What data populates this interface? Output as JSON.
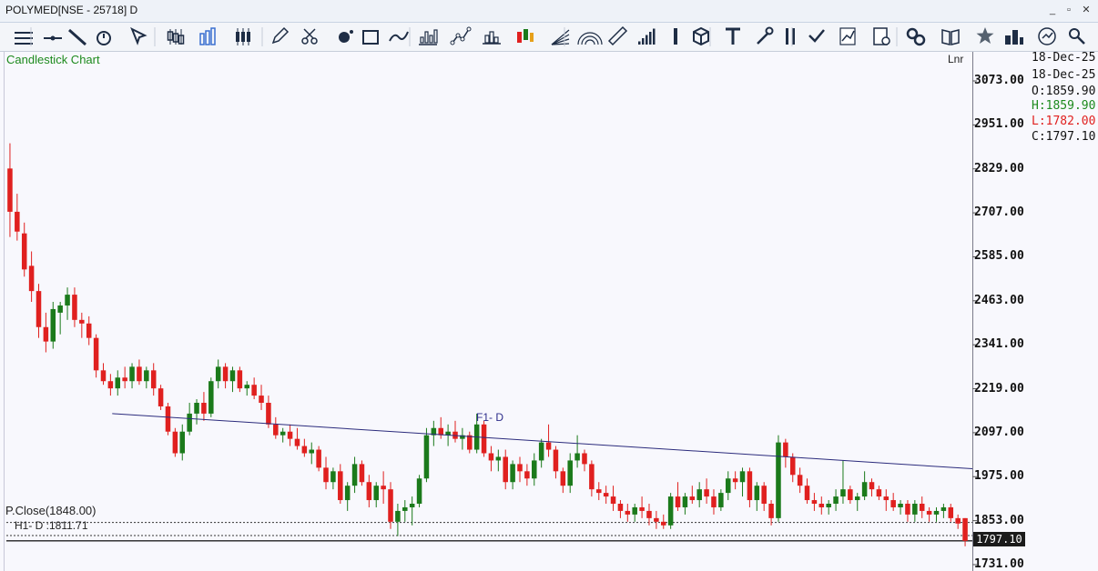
{
  "window": {
    "title": "POLYMED[NSE - 25718] D",
    "min_label": "_",
    "restore_label": "▫",
    "close_label": "✕"
  },
  "toolbar": {
    "icons": [
      "menu-icon",
      "line-tool-icon",
      "trendline-icon",
      "timer-icon",
      "pointer-icon",
      "candle-style-icon",
      "bar-style-icon",
      "candles-icon",
      "pencil-icon",
      "scissors-icon",
      "splat-icon",
      "rectangle-icon",
      "wave-icon",
      "bar-chart-icon",
      "line-chart-icon",
      "histogram-icon",
      "colored-candles-icon",
      "fan-icon",
      "arc-icon",
      "ruler-icon",
      "volume-bars-icon",
      "cursor-bar-icon",
      "cube-icon",
      "text-tool-icon",
      "wrench-icon",
      "pause-bars-icon",
      "down-arrow-icon",
      "scatter-chart-icon",
      "document-settings-icon",
      "link-icon",
      "book-icon",
      "star-icon",
      "grid-icon",
      "compare-icon",
      "zoom-icon"
    ]
  },
  "chart": {
    "title": "Candlestick Chart",
    "scale_mode": "Lnr",
    "info": {
      "date1": "18-Dec-25",
      "date2": "18-Dec-25",
      "open": "O:1859.90",
      "high": "H:1859.90",
      "low": "L:1782.00",
      "close": "C:1797.10"
    },
    "last_price_tag": "1797.10",
    "prev_close_label": "P.Close(1848.00)",
    "h1_label": "H1- D :1811.71",
    "f1_label": "F1- D",
    "colors": {
      "up": "#1b7a1b",
      "down": "#e0201f",
      "trendline": "#2b2b7c",
      "title": "#1d8a1d",
      "high": "#1d8a1d",
      "low": "#e0201f"
    }
  },
  "chart_data": {
    "type": "candlestick",
    "title": "Candlestick Chart",
    "y_ticks": [
      3073.0,
      2951.0,
      2829.0,
      2707.0,
      2585.0,
      2463.0,
      2341.0,
      2219.0,
      2097.0,
      1975.0,
      1853.0,
      1731.0
    ],
    "ylim": [
      1710,
      3160
    ],
    "scale": "linear",
    "reference_lines": [
      {
        "name": "P.Close",
        "value": 1848.0
      },
      {
        "name": "H1- D",
        "value": 1811.71
      }
    ],
    "trendline": {
      "name": "F1- D",
      "from_index": 0.11,
      "from_value": 2150,
      "to_index": 1.0,
      "to_value": 1997
    },
    "last": {
      "open": 1859.9,
      "high": 1859.9,
      "low": 1782.0,
      "close": 1797.1
    },
    "candles": [
      [
        2830,
        2900,
        2640,
        2710
      ],
      [
        2710,
        2760,
        2630,
        2655
      ],
      [
        2650,
        2680,
        2530,
        2550
      ],
      [
        2560,
        2600,
        2460,
        2490
      ],
      [
        2490,
        2510,
        2360,
        2390
      ],
      [
        2390,
        2430,
        2320,
        2350
      ],
      [
        2350,
        2460,
        2330,
        2440
      ],
      [
        2430,
        2460,
        2370,
        2450
      ],
      [
        2450,
        2500,
        2410,
        2480
      ],
      [
        2480,
        2500,
        2390,
        2410
      ],
      [
        2410,
        2430,
        2360,
        2400
      ],
      [
        2400,
        2420,
        2340,
        2360
      ],
      [
        2360,
        2370,
        2250,
        2270
      ],
      [
        2270,
        2290,
        2230,
        2240
      ],
      [
        2240,
        2260,
        2200,
        2220
      ],
      [
        2220,
        2270,
        2200,
        2250
      ],
      [
        2250,
        2280,
        2220,
        2240
      ],
      [
        2240,
        2290,
        2220,
        2280
      ],
      [
        2280,
        2300,
        2230,
        2240
      ],
      [
        2240,
        2280,
        2220,
        2270
      ],
      [
        2270,
        2290,
        2200,
        2220
      ],
      [
        2220,
        2230,
        2160,
        2170
      ],
      [
        2170,
        2180,
        2090,
        2100
      ],
      [
        2100,
        2110,
        2030,
        2040
      ],
      [
        2040,
        2120,
        2020,
        2100
      ],
      [
        2100,
        2180,
        2090,
        2150
      ],
      [
        2150,
        2190,
        2120,
        2180
      ],
      [
        2180,
        2210,
        2130,
        2150
      ],
      [
        2150,
        2250,
        2140,
        2240
      ],
      [
        2240,
        2300,
        2220,
        2280
      ],
      [
        2280,
        2290,
        2220,
        2240
      ],
      [
        2240,
        2280,
        2210,
        2270
      ],
      [
        2270,
        2280,
        2210,
        2220
      ],
      [
        2220,
        2240,
        2200,
        2230
      ],
      [
        2230,
        2250,
        2190,
        2200
      ],
      [
        2200,
        2230,
        2160,
        2180
      ],
      [
        2180,
        2200,
        2110,
        2120
      ],
      [
        2120,
        2140,
        2080,
        2090
      ],
      [
        2090,
        2110,
        2070,
        2100
      ],
      [
        2100,
        2120,
        2060,
        2080
      ],
      [
        2080,
        2110,
        2050,
        2060
      ],
      [
        2060,
        2080,
        2030,
        2040
      ],
      [
        2040,
        2070,
        2010,
        2050
      ],
      [
        2050,
        2060,
        1990,
        2000
      ],
      [
        2000,
        2030,
        1940,
        1960
      ],
      [
        1960,
        2000,
        1940,
        1990
      ],
      [
        1990,
        2010,
        1900,
        1910
      ],
      [
        1910,
        1960,
        1880,
        1950
      ],
      [
        1950,
        2030,
        1930,
        2010
      ],
      [
        2010,
        2020,
        1950,
        1960
      ],
      [
        1960,
        1980,
        1890,
        1910
      ],
      [
        1910,
        1960,
        1890,
        1950
      ],
      [
        1950,
        1990,
        1900,
        1940
      ],
      [
        1940,
        1960,
        1830,
        1850
      ],
      [
        1850,
        1900,
        1810,
        1880
      ],
      [
        1880,
        1910,
        1850,
        1890
      ],
      [
        1890,
        1920,
        1840,
        1900
      ],
      [
        1900,
        1980,
        1890,
        1970
      ],
      [
        1970,
        2110,
        1960,
        2090
      ],
      [
        2090,
        2130,
        2060,
        2110
      ],
      [
        2110,
        2140,
        2080,
        2090
      ],
      [
        2090,
        2120,
        2060,
        2100
      ],
      [
        2100,
        2130,
        2070,
        2080
      ],
      [
        2080,
        2110,
        2050,
        2090
      ],
      [
        2090,
        2100,
        2040,
        2050
      ],
      [
        2050,
        2150,
        2040,
        2120
      ],
      [
        2120,
        2130,
        2030,
        2040
      ],
      [
        2040,
        2060,
        1990,
        2020
      ],
      [
        2020,
        2050,
        1990,
        2030
      ],
      [
        2030,
        2050,
        1940,
        1960
      ],
      [
        1960,
        2020,
        1940,
        2010
      ],
      [
        2010,
        2030,
        1960,
        1990
      ],
      [
        1990,
        2010,
        1950,
        1970
      ],
      [
        1970,
        2040,
        1950,
        2020
      ],
      [
        2020,
        2080,
        2000,
        2070
      ],
      [
        2070,
        2120,
        2030,
        2050
      ],
      [
        2050,
        2060,
        1970,
        1990
      ],
      [
        1990,
        2000,
        1930,
        1950
      ],
      [
        1950,
        2040,
        1930,
        2020
      ],
      [
        2020,
        2090,
        2000,
        2040
      ],
      [
        2040,
        2050,
        1990,
        2010
      ],
      [
        2010,
        2020,
        1920,
        1940
      ],
      [
        1940,
        1960,
        1910,
        1930
      ],
      [
        1930,
        1950,
        1900,
        1920
      ],
      [
        1920,
        1950,
        1880,
        1900
      ],
      [
        1900,
        1910,
        1860,
        1880
      ],
      [
        1880,
        1900,
        1850,
        1870
      ],
      [
        1870,
        1900,
        1850,
        1890
      ],
      [
        1890,
        1920,
        1860,
        1880
      ],
      [
        1880,
        1900,
        1840,
        1860
      ],
      [
        1860,
        1880,
        1830,
        1850
      ],
      [
        1850,
        1870,
        1830,
        1840
      ],
      [
        1840,
        1930,
        1830,
        1920
      ],
      [
        1920,
        1960,
        1880,
        1890
      ],
      [
        1890,
        1930,
        1870,
        1920
      ],
      [
        1920,
        1950,
        1900,
        1910
      ],
      [
        1910,
        1960,
        1890,
        1940
      ],
      [
        1940,
        1970,
        1900,
        1920
      ],
      [
        1920,
        1940,
        1870,
        1890
      ],
      [
        1890,
        1940,
        1880,
        1930
      ],
      [
        1930,
        1990,
        1910,
        1970
      ],
      [
        1970,
        1990,
        1940,
        1960
      ],
      [
        1960,
        2000,
        1920,
        1990
      ],
      [
        1990,
        2000,
        1890,
        1910
      ],
      [
        1910,
        1960,
        1880,
        1950
      ],
      [
        1950,
        1960,
        1880,
        1900
      ],
      [
        1900,
        1910,
        1840,
        1860
      ],
      [
        1860,
        2090,
        1850,
        2070
      ],
      [
        2070,
        2080,
        2000,
        2030
      ],
      [
        2030,
        2040,
        1960,
        1980
      ],
      [
        1980,
        2000,
        1930,
        1950
      ],
      [
        1950,
        1970,
        1900,
        1910
      ],
      [
        1910,
        1930,
        1880,
        1900
      ],
      [
        1900,
        1920,
        1870,
        1890
      ],
      [
        1890,
        1910,
        1870,
        1900
      ],
      [
        1900,
        1940,
        1880,
        1920
      ],
      [
        1920,
        2020,
        1900,
        1940
      ],
      [
        1940,
        1950,
        1900,
        1910
      ],
      [
        1910,
        1930,
        1880,
        1920
      ],
      [
        1920,
        1990,
        1910,
        1960
      ],
      [
        1960,
        1970,
        1920,
        1940
      ],
      [
        1940,
        1950,
        1910,
        1920
      ],
      [
        1920,
        1940,
        1880,
        1910
      ],
      [
        1910,
        1930,
        1880,
        1890
      ],
      [
        1890,
        1910,
        1870,
        1900
      ],
      [
        1900,
        1910,
        1850,
        1870
      ],
      [
        1870,
        1910,
        1850,
        1900
      ],
      [
        1900,
        1920,
        1860,
        1880
      ],
      [
        1880,
        1890,
        1850,
        1870
      ],
      [
        1870,
        1890,
        1850,
        1880
      ],
      [
        1880,
        1900,
        1860,
        1890
      ],
      [
        1890,
        1900,
        1850,
        1860
      ],
      [
        1860,
        1870,
        1830,
        1845
      ],
      [
        1860,
        1860,
        1782,
        1797
      ]
    ]
  }
}
